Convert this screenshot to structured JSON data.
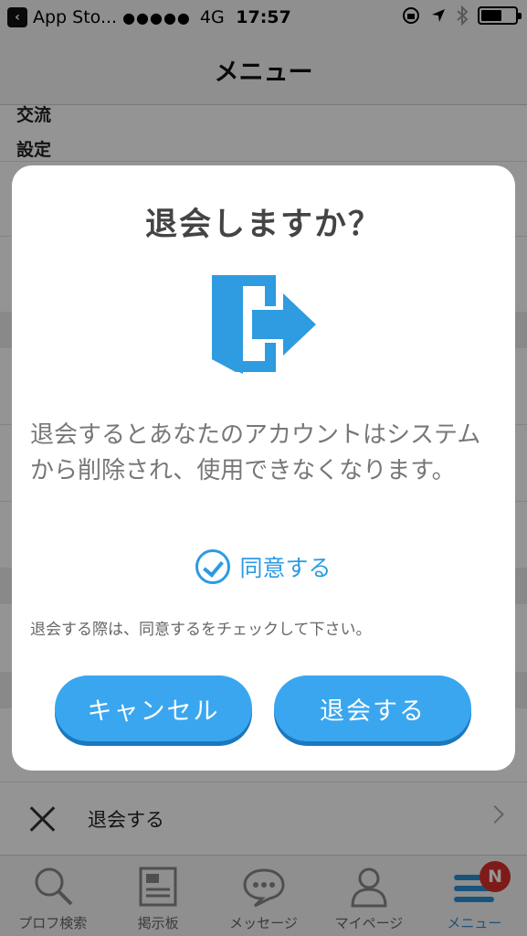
{
  "status_bar": {
    "back_label": "App Sto...",
    "signal": "●●●●●",
    "network": "4G",
    "time": "17:57"
  },
  "nav": {
    "title": "メニュー"
  },
  "background_menu": {
    "items": [
      {
        "label": "交流"
      },
      {
        "label": "設定"
      }
    ],
    "withdraw_label": "退会する"
  },
  "dialog": {
    "title": "退会しますか？",
    "message": "退会するとあなたのアカウントはシステムから削除され、使用できなくなります。",
    "agree_label": "同意する",
    "agree_checked": true,
    "hint": "退会する際は、同意するをチェックして下さい。",
    "cancel_label": "キャンセル",
    "confirm_label": "退会する",
    "accent_color": "#3aa6ef"
  },
  "tab_bar": {
    "tabs": [
      {
        "label": "プロフ検索",
        "icon": "search-icon"
      },
      {
        "label": "掲示板",
        "icon": "board-icon"
      },
      {
        "label": "メッセージ",
        "icon": "message-icon"
      },
      {
        "label": "マイページ",
        "icon": "person-icon"
      },
      {
        "label": "メニュー",
        "icon": "menu-icon",
        "active": true,
        "badge": "N"
      }
    ]
  }
}
